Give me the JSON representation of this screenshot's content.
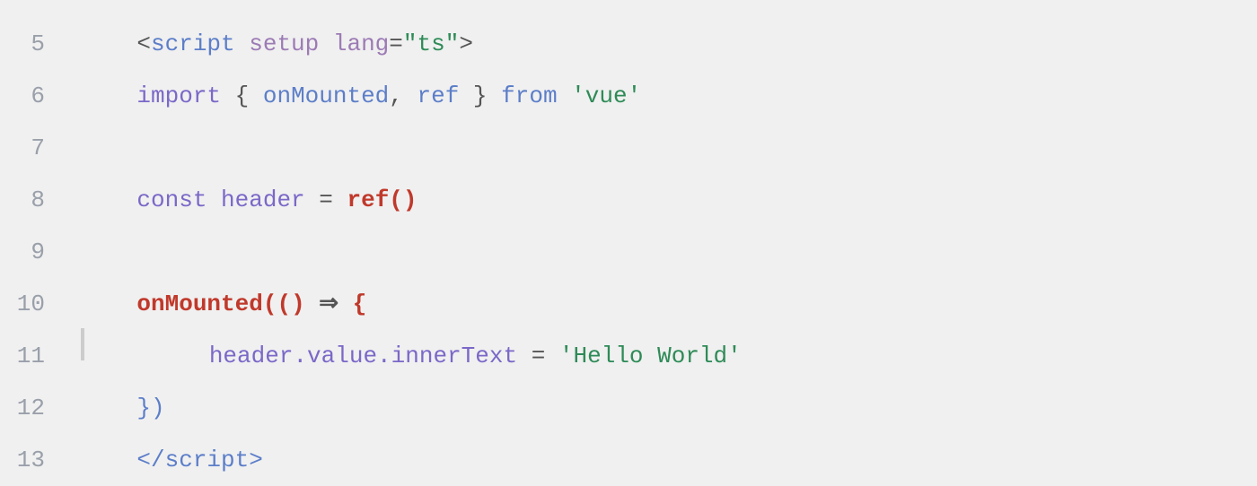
{
  "lines": [
    {
      "number": "5",
      "tokens": [
        {
          "text": "    <",
          "class": "c-punct"
        },
        {
          "text": "script",
          "class": "c-tag"
        },
        {
          "text": " ",
          "class": "c-punct"
        },
        {
          "text": "setup",
          "class": "c-attr"
        },
        {
          "text": " ",
          "class": "c-punct"
        },
        {
          "text": "lang",
          "class": "c-attr"
        },
        {
          "text": "=",
          "class": "c-punct"
        },
        {
          "text": "\"ts\"",
          "class": "c-attr-value"
        },
        {
          "text": ">",
          "class": "c-punct"
        }
      ]
    },
    {
      "number": "6",
      "tokens": [
        {
          "text": "    ",
          "class": "c-punct"
        },
        {
          "text": "import",
          "class": "c-keyword"
        },
        {
          "text": " { ",
          "class": "c-punct"
        },
        {
          "text": "onMounted",
          "class": "c-import-name"
        },
        {
          "text": ", ",
          "class": "c-punct"
        },
        {
          "text": "ref",
          "class": "c-import-name"
        },
        {
          "text": " } ",
          "class": "c-punct"
        },
        {
          "text": "from",
          "class": "c-from"
        },
        {
          "text": " ",
          "class": "c-punct"
        },
        {
          "text": "'vue'",
          "class": "c-string"
        }
      ]
    },
    {
      "number": "7",
      "tokens": []
    },
    {
      "number": "8",
      "tokens": [
        {
          "text": "    ",
          "class": "c-punct"
        },
        {
          "text": "const",
          "class": "c-const"
        },
        {
          "text": " ",
          "class": "c-punct"
        },
        {
          "text": "header",
          "class": "c-varname"
        },
        {
          "text": " = ",
          "class": "c-operator"
        },
        {
          "text": "ref",
          "class": "c-fn-red"
        },
        {
          "text": "()",
          "class": "c-paren"
        }
      ]
    },
    {
      "number": "9",
      "tokens": []
    },
    {
      "number": "10",
      "tokens": [
        {
          "text": "    ",
          "class": "c-punct"
        },
        {
          "text": "onMounted",
          "class": "c-fn-callback"
        },
        {
          "text": "(",
          "class": "c-paren"
        },
        {
          "text": "()",
          "class": "c-paren"
        },
        {
          "text": " ⇒ ",
          "class": "c-arrow"
        },
        {
          "text": "{",
          "class": "c-brace"
        }
      ]
    },
    {
      "number": "11",
      "hasBar": true,
      "tokens": [
        {
          "text": "        ",
          "class": "c-punct"
        },
        {
          "text": "header.value.innerText",
          "class": "c-prop"
        },
        {
          "text": " = ",
          "class": "c-operator"
        },
        {
          "text": "'Hello World'",
          "class": "c-assign-str"
        }
      ]
    },
    {
      "number": "12",
      "tokens": [
        {
          "text": "    ",
          "class": "c-punct"
        },
        {
          "text": "})",
          "class": "c-close-brace"
        }
      ]
    },
    {
      "number": "13",
      "tokens": [
        {
          "text": "    </",
          "class": "c-tag-close"
        },
        {
          "text": "script",
          "class": "c-tag"
        },
        {
          "text": ">",
          "class": "c-tag-close"
        }
      ]
    }
  ]
}
